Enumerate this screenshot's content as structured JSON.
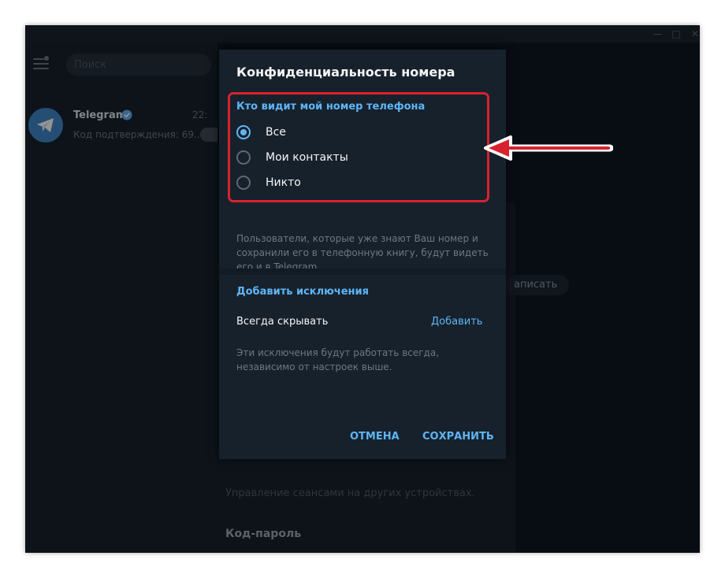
{
  "colors": {
    "accent": "#5eb5f7",
    "annotation": "#d8222f",
    "window_bg": "#0e1621",
    "panel_bg": "#17212b"
  },
  "sidebar": {
    "search_placeholder": "Поиск",
    "chat": {
      "name": "Telegram",
      "time": "22:",
      "preview": "Код подтверждения: 69..."
    }
  },
  "background": {
    "pill_text": "аписать",
    "sessions_text": "Управление сеансами на других устройствах.",
    "code_title": "Код-пароль"
  },
  "dialog": {
    "title": "Конфиденциальность номера",
    "section_title": "Кто видит мой номер телефона",
    "options": [
      {
        "label": "Все",
        "checked": true
      },
      {
        "label": "Мои контакты",
        "checked": false
      },
      {
        "label": "Никто",
        "checked": false
      }
    ],
    "description": "Пользователи, которые уже знают Ваш номер и сохранили его в телефонную книгу, будут видеть его и в Telegram.",
    "exceptions": {
      "title": "Добавить исключения",
      "always_hide_label": "Всегда скрывать",
      "add_label": "Добавить",
      "description": "Эти исключения будут работать всегда, независимо от настроек выше."
    },
    "cancel_label": "ОТМЕНА",
    "save_label": "СОХРАНИТЬ"
  }
}
